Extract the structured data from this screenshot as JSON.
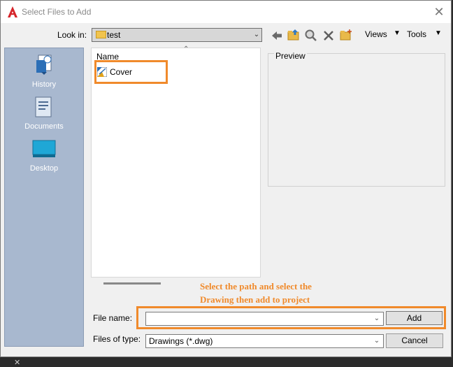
{
  "window": {
    "title": "Select Files to Add",
    "close_glyph": "✕"
  },
  "lookin": {
    "label": "Look in:",
    "value": "test"
  },
  "toolbar": {
    "icons": [
      "back-arrow-icon",
      "up-folder-icon",
      "search-web-icon",
      "delete-icon",
      "new-folder-icon"
    ],
    "views_label": "Views",
    "tools_label": "Tools",
    "dropdown_glyph": "▼"
  },
  "places": [
    {
      "label": "History",
      "icon": "history-icon"
    },
    {
      "label": "Documents",
      "icon": "documents-icon"
    },
    {
      "label": "Desktop",
      "icon": "desktop-icon"
    }
  ],
  "file_list": {
    "column_header": "Name",
    "files": [
      {
        "name": "Cover",
        "icon": "dwg-file-icon"
      }
    ]
  },
  "preview": {
    "label": "Preview"
  },
  "annotation": {
    "line1": "Select the path and select the",
    "line2": "Drawing then add to project",
    "color": "#f08a2b"
  },
  "filename": {
    "label": "File name:",
    "value": ""
  },
  "filetype": {
    "label": "Files of type:",
    "value": "Drawings (*.dwg)"
  },
  "buttons": {
    "add": "Add",
    "cancel": "Cancel"
  }
}
